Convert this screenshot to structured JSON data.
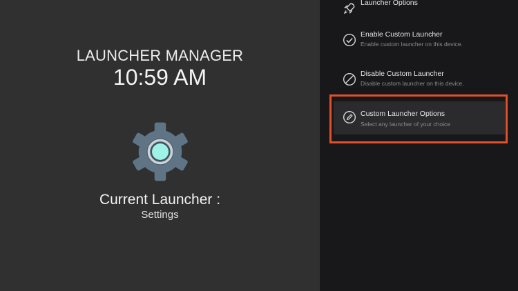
{
  "left": {
    "app_title": "LAUNCHER MANAGER",
    "clock": "10:59 AM",
    "current_label": "Current Launcher :",
    "current_value": "Settings",
    "gear_icon": "settings-gear-icon"
  },
  "menu": {
    "items": [
      {
        "title": "Launcher Options",
        "subtitle": "",
        "icon": "rocket-icon"
      },
      {
        "title": "Enable Custom Launcher",
        "subtitle": "Enable custom launcher on this device.",
        "icon": "check-circle-icon"
      },
      {
        "title": "Disable Custom Launcher",
        "subtitle": "Disable custom launcher on this device.",
        "icon": "block-icon"
      },
      {
        "title": "Custom Launcher Options",
        "subtitle": "Select any launcher of your choice",
        "icon": "edit-circle-icon"
      }
    ],
    "selected_index": 3
  },
  "colors": {
    "highlight": "#e3502a",
    "left_bg": "#303031",
    "right_bg": "#18181a",
    "gear": "#5f7585",
    "gear_center": "#9ff2e6"
  }
}
